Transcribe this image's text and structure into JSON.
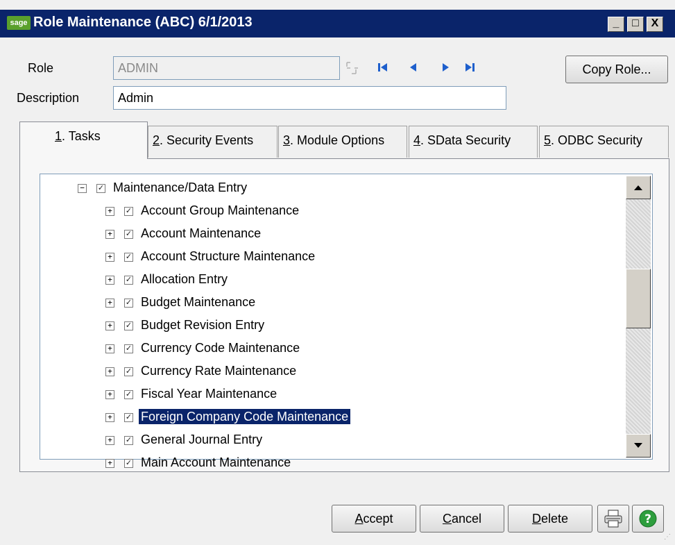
{
  "window": {
    "logo": "sage",
    "title": "Role Maintenance (ABC) 6/1/2013",
    "controls": {
      "minimize": "_",
      "maximize": "□",
      "close": "X"
    }
  },
  "form": {
    "role_label": "Role",
    "role_value": "ADMIN",
    "description_label": "Description",
    "description_value": "Admin",
    "copy_role_button": "Copy Role..."
  },
  "nav_icons": [
    "lookup-icon",
    "first-record-icon",
    "previous-record-icon",
    "next-record-icon",
    "last-record-icon"
  ],
  "tabs": [
    {
      "num": "1",
      "label": ". Tasks",
      "active": true
    },
    {
      "num": "2",
      "label": ". Security Events",
      "active": false
    },
    {
      "num": "3",
      "label": ". Module Options",
      "active": false
    },
    {
      "num": "4",
      "label": ". SData Security",
      "active": false
    },
    {
      "num": "5",
      "label": ". ODBC Security",
      "active": false
    }
  ],
  "tree": {
    "parent": {
      "label": "Maintenance/Data Entry",
      "expanded": true,
      "checked": true
    },
    "children": [
      {
        "label": "Account Group Maintenance",
        "checked": true,
        "selected": false
      },
      {
        "label": "Account Maintenance",
        "checked": true,
        "selected": false
      },
      {
        "label": "Account Structure Maintenance",
        "checked": true,
        "selected": false
      },
      {
        "label": "Allocation Entry",
        "checked": true,
        "selected": false
      },
      {
        "label": "Budget Maintenance",
        "checked": true,
        "selected": false
      },
      {
        "label": "Budget Revision Entry",
        "checked": true,
        "selected": false
      },
      {
        "label": "Currency Code Maintenance",
        "checked": true,
        "selected": false
      },
      {
        "label": "Currency Rate Maintenance",
        "checked": true,
        "selected": false
      },
      {
        "label": "Fiscal Year Maintenance",
        "checked": true,
        "selected": false
      },
      {
        "label": "Foreign Company Code Maintenance",
        "checked": true,
        "selected": true
      },
      {
        "label": "General Journal Entry",
        "checked": true,
        "selected": false
      },
      {
        "label": "Main Account Maintenance",
        "checked": true,
        "selected": false
      }
    ]
  },
  "buttons": {
    "accept": {
      "u": "A",
      "rest": "ccept"
    },
    "cancel": {
      "u": "C",
      "rest": "ancel"
    },
    "delete": {
      "u": "D",
      "rest": "elete"
    }
  },
  "colors": {
    "titlebar": "#0a246a",
    "selection": "#0a246a",
    "help": "#2e9e3e"
  }
}
